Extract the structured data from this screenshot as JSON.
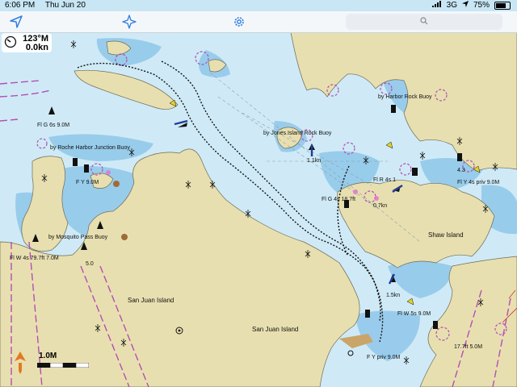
{
  "status": {
    "time": "6:06 PM",
    "date": "Thu Jun 20",
    "network": "3G",
    "battery": "75%",
    "battery_level": 0.75
  },
  "toolbar": {
    "search_placeholder": ""
  },
  "readout": {
    "depth": "123°M",
    "speed": "0.0kn"
  },
  "scale": {
    "label": "1.0M"
  },
  "islands": {
    "san_juan_1": "San Juan Island",
    "san_juan_2": "San Juan Island",
    "shaw": "Shaw Island"
  },
  "chart_labels": {
    "harbor_rock": "by Harbor Rock Buoy",
    "jones_rock": "by Jones Island Rock Buoy",
    "roche_harbor": "by Roche Harbor Junction Buoy",
    "mosquito": "by Mosquito Pass Buoy",
    "fl_g": "Fl G 6s 9.0M",
    "fy": "F Y 9.0M",
    "flw4": "Fl W 4s 79.7ft 7.0M",
    "fl_r": "Fl R 4s 1",
    "fl_g2": "Fl G 4s 18.7ft",
    "fl_y": "Fl Y 4s priv 9.0M",
    "flw5": "Fl W 5s 9.0M",
    "fy_priv": "F Y priv 9.0M",
    "depth17": "17.7ft 5.0M",
    "current1": "1.1kn",
    "current2": "0.7kn",
    "current3": "1.5kn",
    "num_43": "4.3",
    "num_50": "5.0"
  }
}
